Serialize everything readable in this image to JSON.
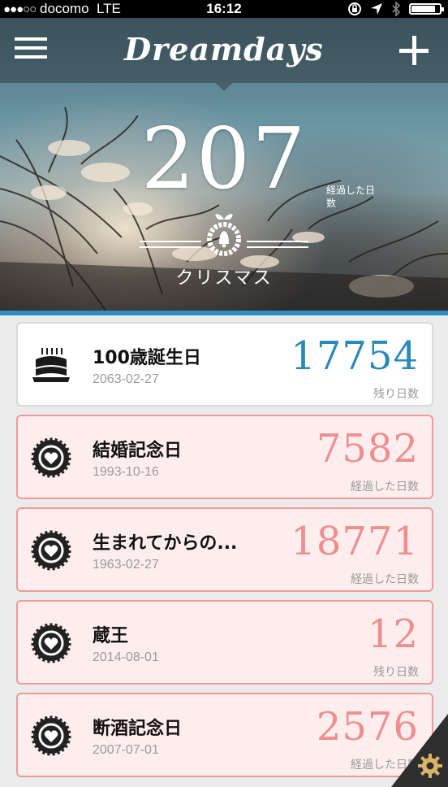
{
  "status_bar": {
    "signal_dots": "●●●○○",
    "carrier": "docomo",
    "network": "LTE",
    "time": "16:12",
    "icons": [
      "orientation-lock-icon",
      "location-arrow-icon",
      "bluetooth-icon",
      "battery-icon"
    ],
    "battery_level": 0.85
  },
  "header": {
    "title": "Dreamdays",
    "menu_icon": "hamburger-menu-icon",
    "add_icon": "plus-icon"
  },
  "hero": {
    "count": "207",
    "unit": "経過した日数",
    "icon": "wreath-bell-icon",
    "event_name": "クリスマス",
    "accent_color": "#2f8dc2"
  },
  "events": [
    {
      "name": "100歳誕生日",
      "date": "2063-02-27",
      "count": "17754",
      "unit": "残り日数",
      "icon": "birthday-cake-icon",
      "highlight": false,
      "color": "#2a8ab7"
    },
    {
      "name": "結婚記念日",
      "date": "1993-10-16",
      "count": "7582",
      "unit": "経過した日数",
      "icon": "heart-badge-icon",
      "highlight": true,
      "color": "#ef8e8e"
    },
    {
      "name": "生まれてからの...",
      "date": "1963-02-27",
      "count": "18771",
      "unit": "経過した日数",
      "icon": "heart-badge-icon",
      "highlight": true,
      "color": "#ef8e8e"
    },
    {
      "name": "蔵王",
      "date": "2014-08-01",
      "count": "12",
      "unit": "残り日数",
      "icon": "heart-badge-icon",
      "highlight": true,
      "color": "#ef8e8e"
    },
    {
      "name": "断酒記念日",
      "date": "2007-07-01",
      "count": "2576",
      "unit": "経過した日数",
      "icon": "heart-badge-icon",
      "highlight": true,
      "color": "#ef8e8e"
    }
  ],
  "settings": {
    "icon": "gear-icon"
  }
}
